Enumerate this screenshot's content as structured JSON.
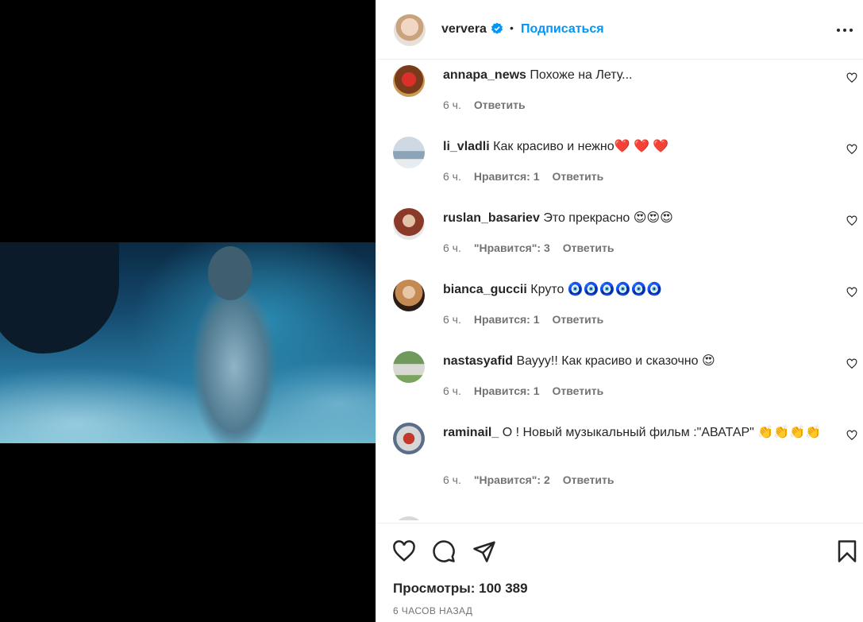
{
  "post": {
    "username": "ververa",
    "follow_label": "Подписаться",
    "dot": "•"
  },
  "comments": [
    {
      "username": "annapa_news",
      "text": "Похоже на Лету...",
      "time": "6 ч.",
      "likes": "",
      "reply": "Ответить"
    },
    {
      "username": "li_vladli",
      "text": "Как красиво и нежно❤️ ❤️ ❤️",
      "time": "6 ч.",
      "likes": "Нравится: 1",
      "reply": "Ответить"
    },
    {
      "username": "ruslan_basariev",
      "text": "Это прекрасно 😍😍😍",
      "time": "6 ч.",
      "likes": "\"Нравится\": 3",
      "reply": "Ответить"
    },
    {
      "username": "bianca_guccii",
      "text": "Круто 🧿🧿🧿🧿🧿🧿",
      "time": "6 ч.",
      "likes": "Нравится: 1",
      "reply": "Ответить"
    },
    {
      "username": "nastasyafid",
      "text": "Вауyy!! Как красиво и сказочно 😍",
      "time": "6 ч.",
      "likes": "Нравится: 1",
      "reply": "Ответить"
    },
    {
      "username": "raminail_",
      "text": "О ! Новый музыкальный фильм :\"АВАТАР\" 👏👏👏👏",
      "time": "6 ч.",
      "likes": "\"Нравится\": 2",
      "reply": "Ответить"
    }
  ],
  "footer": {
    "views": "Просмотры: 100 389",
    "time": "6 ЧАСОВ НАЗАД"
  },
  "icons": [
    "verified-badge-icon",
    "more-options-icon",
    "heart-icon",
    "comment-icon",
    "share-icon",
    "bookmark-icon"
  ],
  "colors": {
    "accent": "#0095f6",
    "secondary_text": "#737373",
    "primary_text": "#262626"
  }
}
